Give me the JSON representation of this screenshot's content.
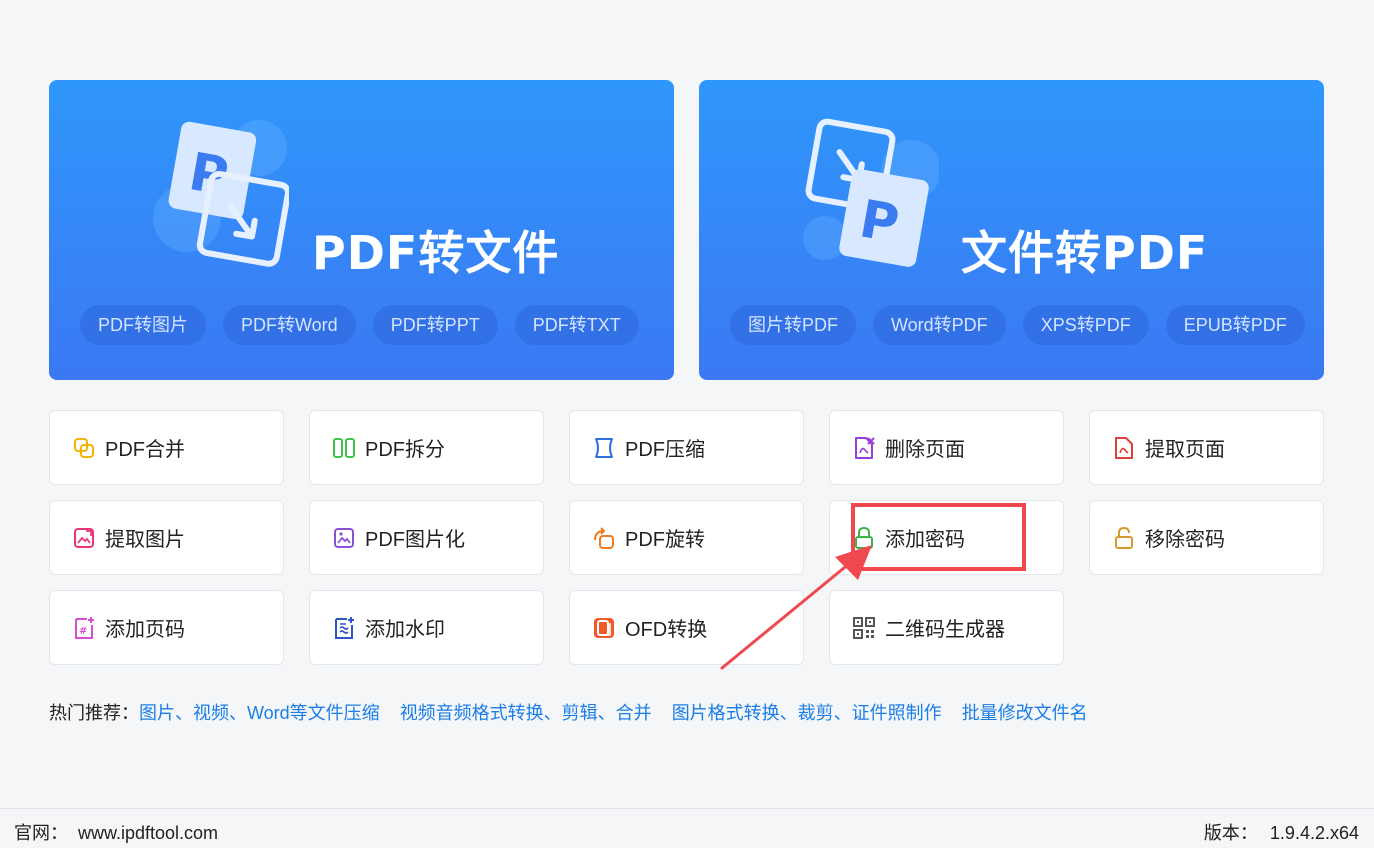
{
  "hero_left": {
    "title": "PDF转文件",
    "chips": [
      "PDF转图片",
      "PDF转Word",
      "PDF转PPT",
      "PDF转TXT"
    ]
  },
  "hero_right": {
    "title": "文件转PDF",
    "chips": [
      "图片转PDF",
      "Word转PDF",
      "XPS转PDF",
      "EPUB转PDF"
    ]
  },
  "tools": {
    "row1": [
      "PDF合并",
      "PDF拆分",
      "PDF压缩",
      "删除页面",
      "提取页面"
    ],
    "row2": [
      "提取图片",
      "PDF图片化",
      "PDF旋转",
      "添加密码",
      "移除密码"
    ],
    "row3": [
      "添加页码",
      "添加水印",
      "OFD转换",
      "二维码生成器"
    ]
  },
  "icons": {
    "merge": "merge-icon",
    "split": "split-icon",
    "compress": "compress-icon",
    "delete_page": "delete-page-icon",
    "extract_page": "extract-page-icon",
    "extract_image": "extract-image-icon",
    "to_image": "pdf-to-image-icon",
    "rotate": "rotate-icon",
    "lock": "lock-icon",
    "unlock": "unlock-icon",
    "page_number": "page-number-icon",
    "watermark": "watermark-icon",
    "ofd": "ofd-icon",
    "qr": "qr-code-icon"
  },
  "hot": {
    "label": "热门推荐：",
    "links": [
      "图片、视频、Word等文件压缩",
      "视频音频格式转换、剪辑、合并",
      "图片格式转换、裁剪、证件照制作",
      "批量修改文件名"
    ]
  },
  "footer": {
    "site_label": "官网：",
    "site_url": "www.ipdftool.com",
    "version_label": "版本：",
    "version": "1.9.4.2.x64"
  },
  "colors": {
    "hero_top": "#2f97fb",
    "hero_bottom": "#3b78f2",
    "link": "#1a7ee8",
    "annotation": "#f0484f"
  }
}
